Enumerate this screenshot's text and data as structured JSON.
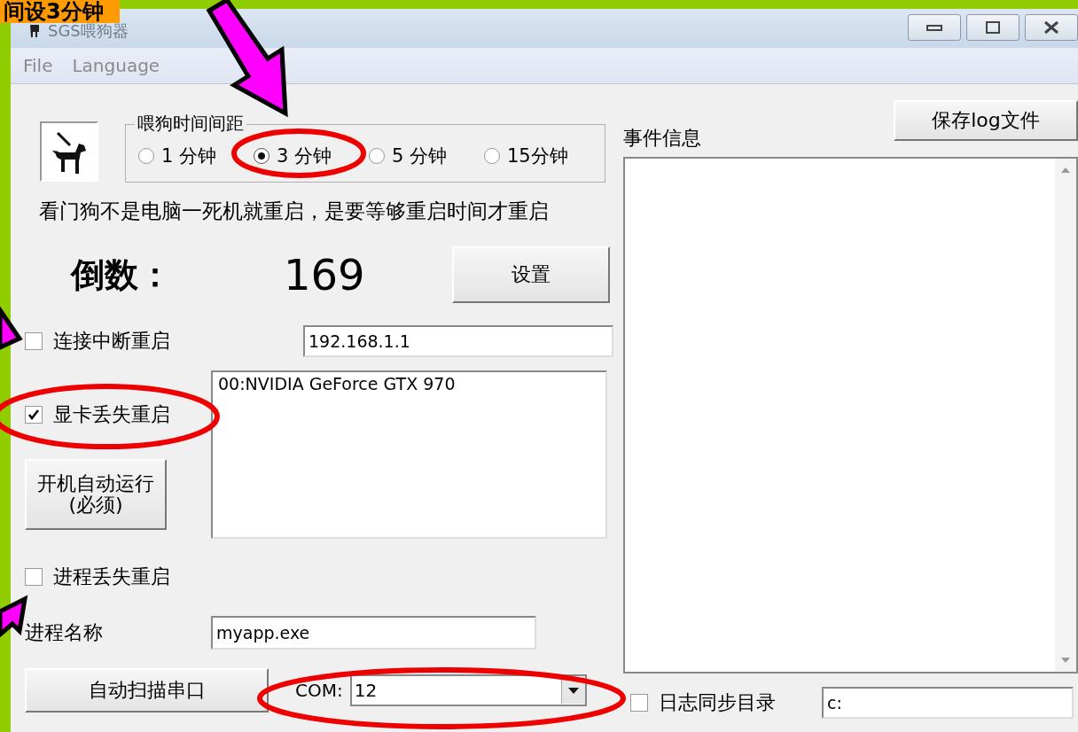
{
  "annotation_label": {
    "text": "间设3分钟"
  },
  "window": {
    "title": "SGS喂狗器"
  },
  "menu": [
    "File",
    "Language"
  ],
  "interval_group": {
    "title": "喂狗时间间距",
    "options": [
      {
        "label": "1 分钟",
        "selected": false
      },
      {
        "label": "3 分钟",
        "selected": true
      },
      {
        "label": "5 分钟",
        "selected": false
      },
      {
        "label": "15分钟",
        "selected": false
      }
    ]
  },
  "note": "看门狗不是电脑一死机就重启，是要等够重启时间才重启",
  "countdown": {
    "label": "倒数：",
    "value": "169"
  },
  "set_button": "设置",
  "network_restart": {
    "label": "连接中断重启",
    "checked": false,
    "address": "192.168.1.1"
  },
  "gpu_restart": {
    "label": "显卡丢失重启",
    "checked": true
  },
  "gpu_list": [
    "00:NVIDIA GeForce GTX 970"
  ],
  "autostart_button": [
    "开机自动运行",
    "(必须)"
  ],
  "process_restart": {
    "label": "进程丢失重启",
    "checked": false
  },
  "process_name": {
    "label": "进程名称",
    "value": "myapp.exe"
  },
  "scan_button": "自动扫描串口",
  "com": {
    "label": "COM:",
    "value": "12"
  },
  "save_log_button": "保存log文件",
  "events": {
    "label": "事件信息"
  },
  "log_sync": {
    "label": "日志同步目录",
    "checked": false,
    "value": "c:"
  }
}
